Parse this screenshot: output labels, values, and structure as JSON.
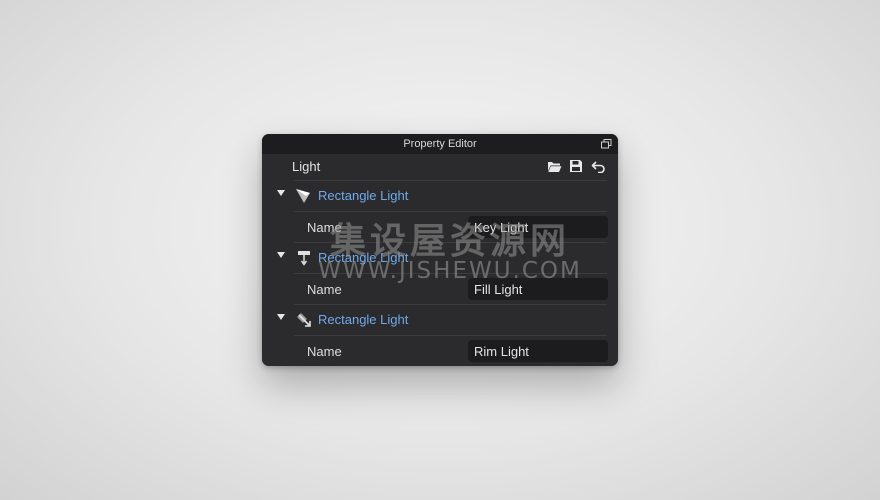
{
  "window": {
    "title": "Property Editor"
  },
  "header": {
    "label": "Light",
    "icons": [
      "folder-open-icon",
      "save-icon",
      "undo-icon"
    ]
  },
  "groups": [
    {
      "title": "Rectangle Light",
      "icon": "key-light-icon",
      "prop_label": "Name",
      "prop_value": "Key Light"
    },
    {
      "title": "Rectangle Light",
      "icon": "fill-light-icon",
      "prop_label": "Name",
      "prop_value": "Fill Light"
    },
    {
      "title": "Rectangle Light",
      "icon": "rim-light-icon",
      "prop_label": "Name",
      "prop_value": "Rim Light"
    }
  ],
  "watermark": {
    "cn": "集设屋资源网",
    "en": "WWW.JISHEWU.COM"
  },
  "colors": {
    "panel_bg": "#2b2b2d",
    "titlebar_bg": "#1d1d1f",
    "accent_blue": "#6fa9ea",
    "input_bg": "#1c1c1e"
  }
}
